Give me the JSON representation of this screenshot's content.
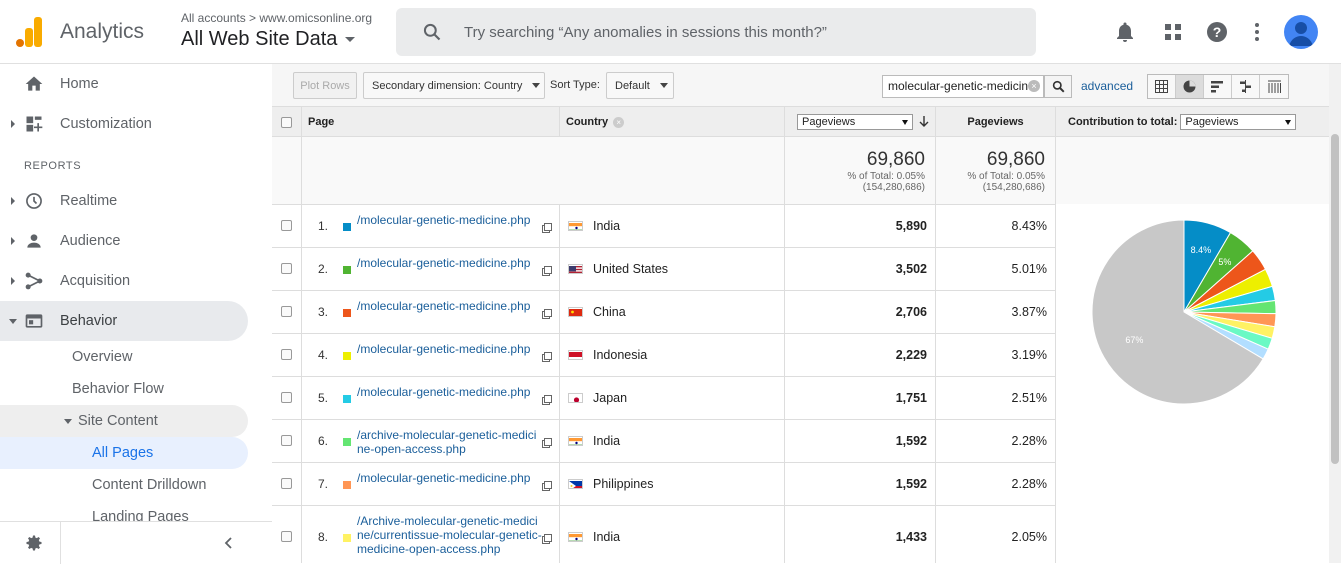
{
  "header": {
    "app_name": "Analytics",
    "account_crumb": "All accounts > www.omicsonline.org",
    "view_name": "All Web Site Data",
    "search_placeholder": "Try searching “Any anomalies in sessions this month?”"
  },
  "sidebar": {
    "home": "Home",
    "customization": "Customization",
    "reports_label": "REPORTS",
    "realtime": "Realtime",
    "audience": "Audience",
    "acquisition": "Acquisition",
    "behavior": "Behavior",
    "overview": "Overview",
    "behavior_flow": "Behavior Flow",
    "site_content": "Site Content",
    "all_pages": "All Pages",
    "content_drilldown": "Content Drilldown",
    "landing_pages": "Landing Pages"
  },
  "toolbar": {
    "plot_rows": "Plot Rows",
    "secondary_dimension": "Secondary dimension: Country",
    "sort_type_label": "Sort Type:",
    "sort_type_value": "Default",
    "filter_value": "molecular-genetic-medicine",
    "advanced": "advanced"
  },
  "table": {
    "col_page": "Page",
    "col_country": "Country",
    "col_metric_select": "Pageviews",
    "col_pageviews": "Pageviews",
    "col_contribution": "Contribution to total:",
    "contribution_select": "Pageviews",
    "totals": {
      "value_a": "69,860",
      "pct_a": "% of Total: 0.05%",
      "base_a": "(154,280,686)",
      "value_b": "69,860",
      "pct_b": "% of Total: 0.05%",
      "base_b": "(154,280,686)"
    },
    "rows": [
      {
        "num": "1.",
        "color": "#058dc7",
        "page": "/molecular-genetic-medicine.php",
        "country": "India",
        "flag": "in",
        "pageviews": "5,890",
        "pct": "8.43%"
      },
      {
        "num": "2.",
        "color": "#50b432",
        "page": "/molecular-genetic-medicine.php",
        "country": "United States",
        "flag": "us",
        "pageviews": "3,502",
        "pct": "5.01%"
      },
      {
        "num": "3.",
        "color": "#ed561b",
        "page": "/molecular-genetic-medicine.php",
        "country": "China",
        "flag": "cn",
        "pageviews": "2,706",
        "pct": "3.87%"
      },
      {
        "num": "4.",
        "color": "#edef00",
        "page": "/molecular-genetic-medicine.php",
        "country": "Indonesia",
        "flag": "id",
        "pageviews": "2,229",
        "pct": "3.19%"
      },
      {
        "num": "5.",
        "color": "#24cbe5",
        "page": "/molecular-genetic-medicine.php",
        "country": "Japan",
        "flag": "jp",
        "pageviews": "1,751",
        "pct": "2.51%"
      },
      {
        "num": "6.",
        "color": "#64e572",
        "page": "/archive-molecular-genetic-medicine-open-access.php",
        "country": "India",
        "flag": "in",
        "pageviews": "1,592",
        "pct": "2.28%"
      },
      {
        "num": "7.",
        "color": "#ff9655",
        "page": "/molecular-genetic-medicine.php",
        "country": "Philippines",
        "flag": "ph",
        "pageviews": "1,592",
        "pct": "2.28%"
      },
      {
        "num": "8.",
        "color": "#fff263",
        "page": "/Archive-molecular-genetic-medicine/currentissue-molecular-genetic-medicine-open-access.php",
        "country": "India",
        "flag": "in",
        "pageviews": "1,433",
        "pct": "2.05%"
      }
    ]
  },
  "chart_data": {
    "type": "pie",
    "title": "",
    "slices": [
      {
        "value": 8.43,
        "color": "#058dc7",
        "label": "8.4%"
      },
      {
        "value": 5.01,
        "color": "#50b432",
        "label": "5%"
      },
      {
        "value": 3.87,
        "color": "#ed561b",
        "label": ""
      },
      {
        "value": 3.19,
        "color": "#edef00",
        "label": ""
      },
      {
        "value": 2.51,
        "color": "#24cbe5",
        "label": ""
      },
      {
        "value": 2.28,
        "color": "#64e572",
        "label": ""
      },
      {
        "value": 2.28,
        "color": "#ff9655",
        "label": ""
      },
      {
        "value": 2.05,
        "color": "#fff263",
        "label": ""
      },
      {
        "value": 2.0,
        "color": "#6af9c4",
        "label": ""
      },
      {
        "value": 1.9,
        "color": "#b2deff",
        "label": ""
      },
      {
        "value": 66.48,
        "color": "#c8c8c8",
        "label": "67%"
      }
    ]
  }
}
